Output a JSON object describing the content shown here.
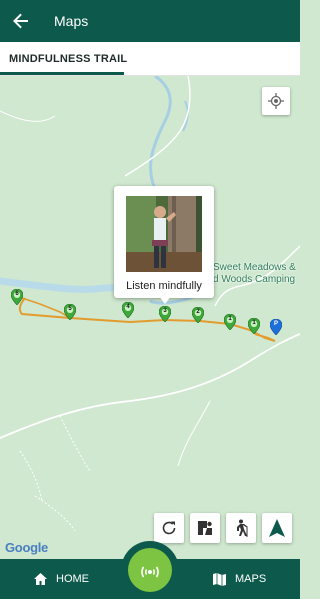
{
  "appbar": {
    "title": "Maps",
    "back_icon": "arrow-left-icon"
  },
  "tabs": [
    {
      "label": "MINDFULNESS TRAIL",
      "selected": true
    }
  ],
  "map": {
    "popup": {
      "caption": "Listen mindfully"
    },
    "place_labels": [
      "Sweet Meadows &",
      "d Woods Camping"
    ],
    "markers": [
      "6",
      "5",
      "4",
      "3",
      "2",
      "1",
      "1",
      "P"
    ],
    "attribution": "Google"
  },
  "map_controls": [
    "refresh-icon",
    "map-toggle-icon",
    "hiking-icon",
    "navigation-icon"
  ],
  "bottom_nav": {
    "home_label": "HOME",
    "maps_label": "MAPS",
    "center_icon": "gps-signal-icon"
  },
  "colors": {
    "primary": "#0d5a4c",
    "accent": "#7cc441",
    "trail": "#e39b2e",
    "marker_green": "#3ea83a",
    "marker_parking": "#1e6fd9",
    "map_land": "#cfe8cf"
  }
}
